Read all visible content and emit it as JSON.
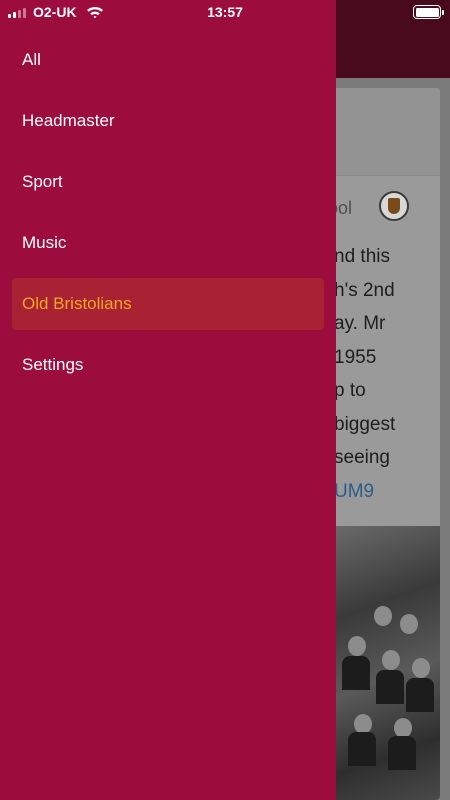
{
  "status_bar": {
    "carrier": "O2-UK",
    "time": "13:57",
    "signal_bars_filled": 2,
    "signal_bars_total": 4,
    "wifi_icon": "wifi-icon",
    "battery_icon": "battery-full-icon"
  },
  "drawer": {
    "background_color": "#9c0c3c",
    "active_color": "#f5a623",
    "items": [
      {
        "label": "All",
        "active": false
      },
      {
        "label": "Headmaster",
        "active": false
      },
      {
        "label": "Sport",
        "active": false
      },
      {
        "label": "Music",
        "active": false
      },
      {
        "label": "Old Bristolians",
        "active": true
      },
      {
        "label": "Settings",
        "active": false
      }
    ]
  },
  "background_post": {
    "school_name_fragment": "hool",
    "text_lines": [
      "nd this",
      "h's 2nd",
      "ay. Mr",
      "1955",
      "p to",
      "biggest",
      "seeing"
    ],
    "link_fragment": "UM9"
  }
}
